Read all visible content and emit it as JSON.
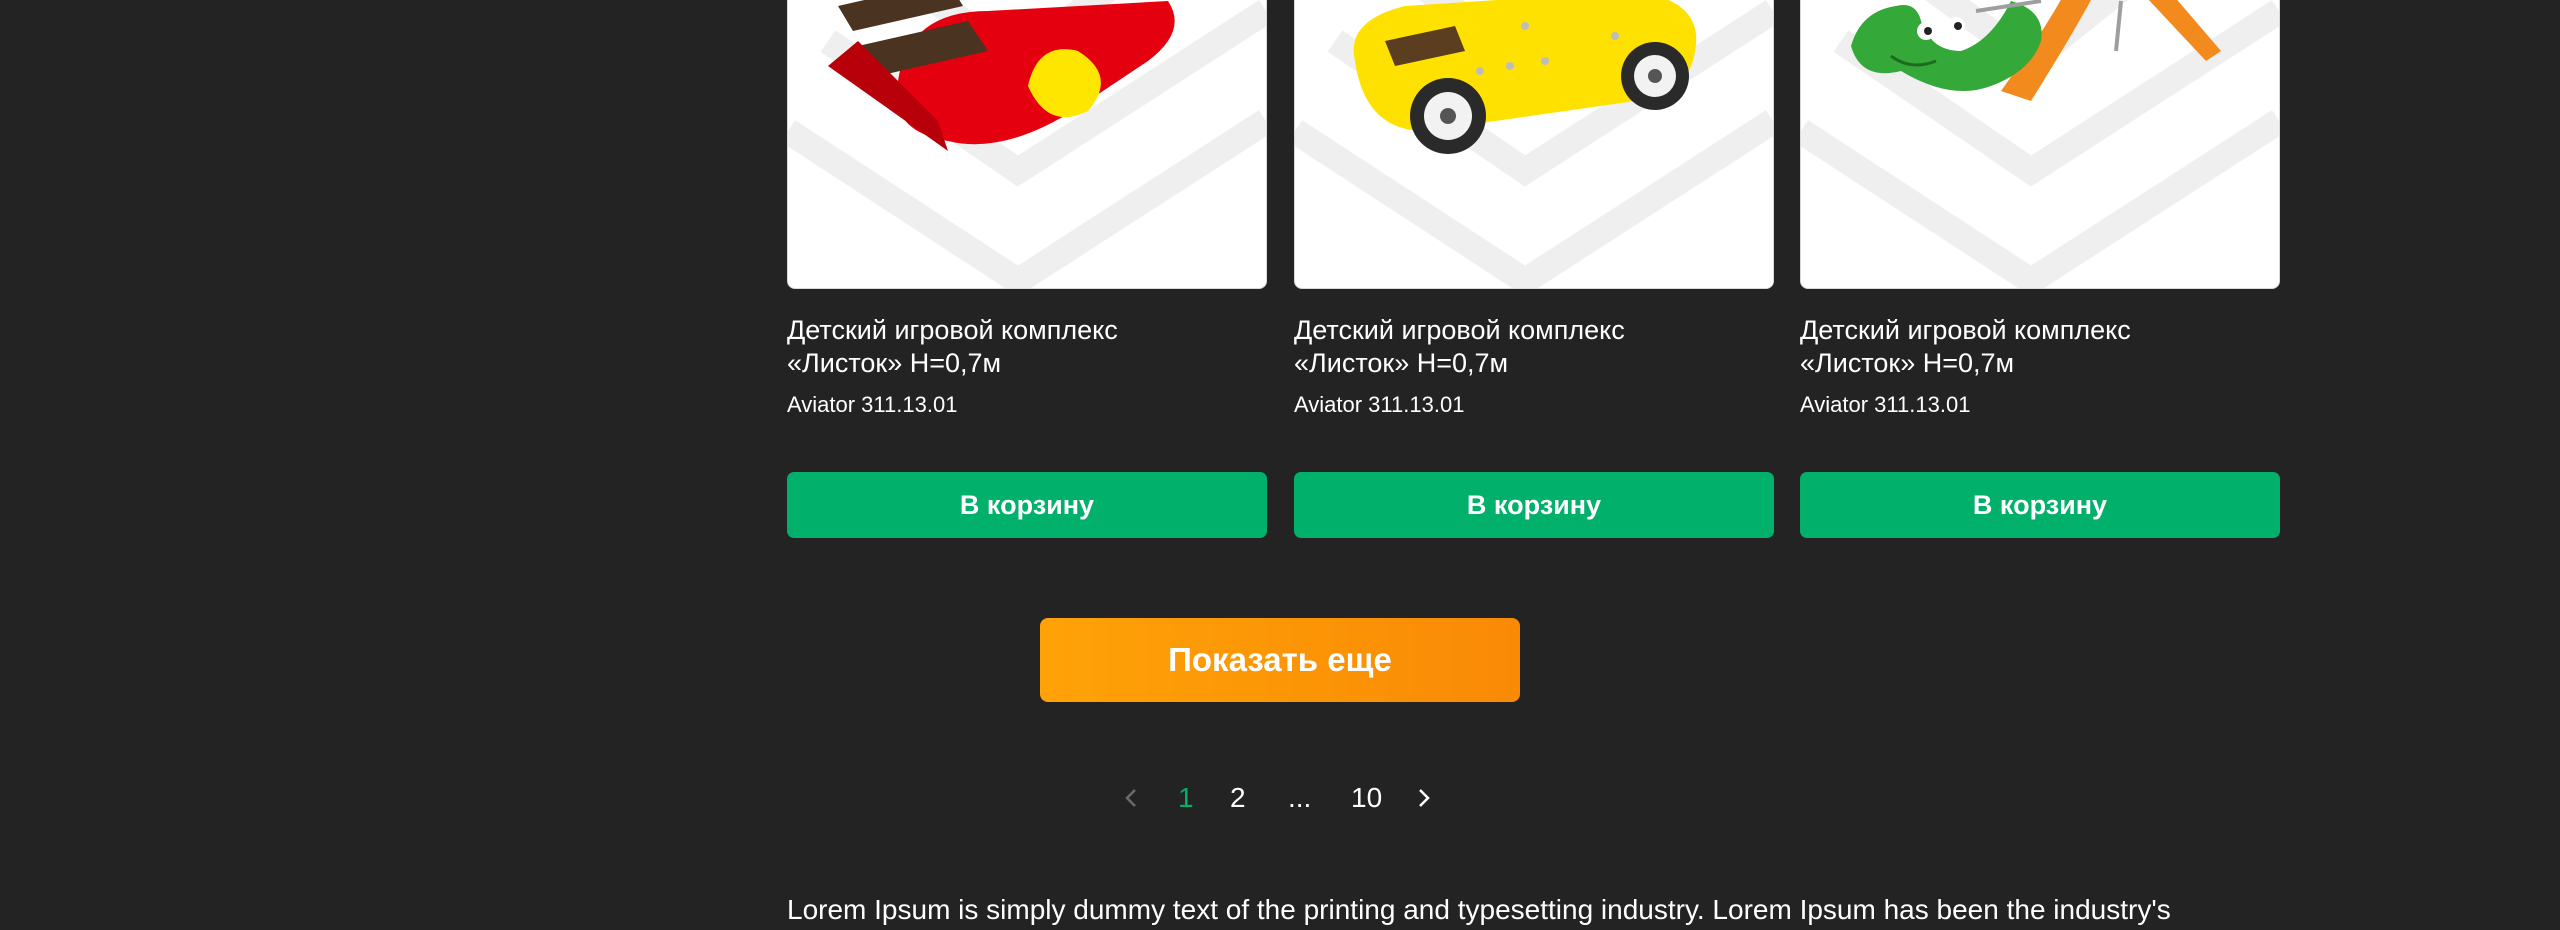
{
  "products": [
    {
      "title_line1": "Детский игровой комплекс",
      "title_line2": "«Листок» Н=0,7м",
      "sku": "Aviator 311.13.01",
      "button": "В корзину",
      "image": "red-playground-stairs"
    },
    {
      "title_line1": "Детский игровой комплекс",
      "title_line2": "«Листок» Н=0,7м",
      "sku": "Aviator 311.13.01",
      "button": "В корзину",
      "image": "yellow-car-playhouse"
    },
    {
      "title_line1": "Детский игровой комплекс",
      "title_line2": "«Листок» Н=0,7м",
      "sku": "Aviator 311.13.01",
      "button": "В корзину",
      "image": "green-dragon-slide"
    }
  ],
  "show_more": "Показать еще",
  "pagination": {
    "prev_icon": "chevron-left-icon",
    "pages": [
      "1",
      "2",
      "...",
      "10"
    ],
    "current": "1",
    "next_icon": "chevron-right-icon"
  },
  "description": "Lorem Ipsum is simply dummy text of the printing and typesetting industry. Lorem Ipsum has been the industry's",
  "colors": {
    "background": "#232323",
    "accent_green": "#00b06b",
    "accent_orange": "#ff9f07"
  }
}
